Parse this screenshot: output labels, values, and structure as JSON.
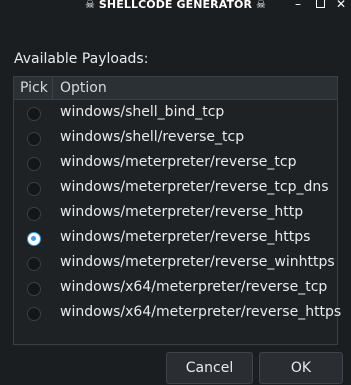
{
  "window": {
    "title": "☠ SHELLCODE GENERATOR ☠",
    "controls": {
      "minimize": "–",
      "close": "✕"
    }
  },
  "payloads": {
    "heading": "Available Payloads:",
    "columns": [
      "Pick",
      "Option"
    ],
    "selected_index": 5,
    "items": [
      "windows/shell_bind_tcp",
      "windows/shell/reverse_tcp",
      "windows/meterpreter/reverse_tcp",
      "windows/meterpreter/reverse_tcp_dns",
      "windows/meterpreter/reverse_http",
      "windows/meterpreter/reverse_https",
      "windows/meterpreter/reverse_winhttps",
      "windows/x64/meterpreter/reverse_tcp",
      "windows/x64/meterpreter/reverse_https"
    ]
  },
  "buttons": {
    "cancel": "Cancel",
    "ok": "OK"
  },
  "colors": {
    "background": "#1b1e20",
    "header": "#2b3035",
    "accent": "#3d9ee0"
  }
}
